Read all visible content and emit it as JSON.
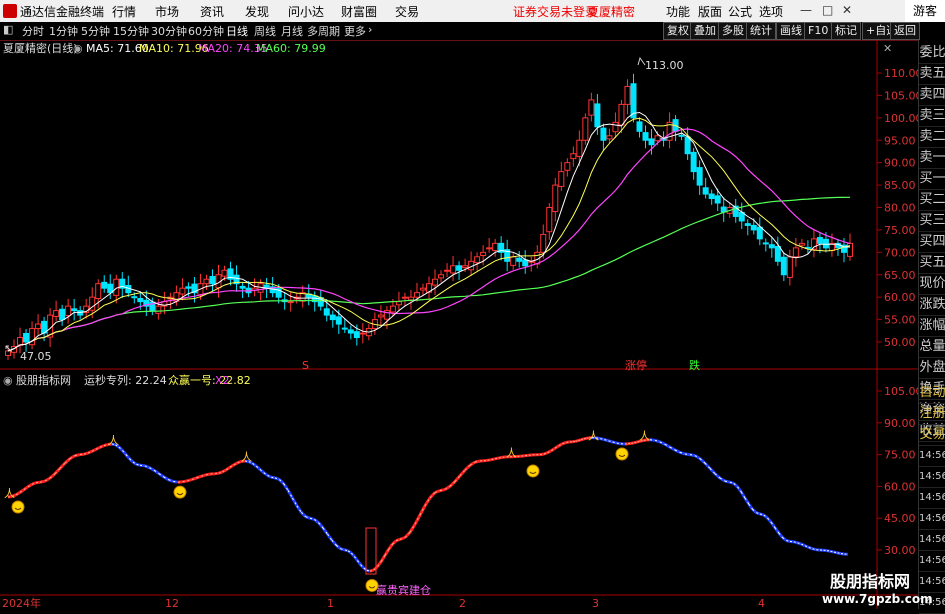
{
  "titlebar": {
    "app_title": "通达信金融终端",
    "menus": [
      "行情",
      "市场",
      "资讯",
      "发现",
      "问小达",
      "财富圈",
      "交易"
    ],
    "warning": "证券交易未登录",
    "warning2": "夏厦精密",
    "right_menus": [
      "功能",
      "版面",
      "公式",
      "选项"
    ],
    "guest": "游客"
  },
  "periods": [
    "分时",
    "1分钟",
    "5分钟",
    "15分钟",
    "30分钟",
    "60分钟",
    "日线",
    "周线",
    "月线",
    "多周期",
    "更多"
  ],
  "active_period": "日线",
  "right_tools": [
    "复权",
    "叠加",
    "多股",
    "统计",
    "画线",
    "F10",
    "标记",
    "+自选",
    "返回"
  ],
  "rail_items": [
    "委比",
    "卖五",
    "卖四",
    "卖三",
    "卖二",
    "卖一",
    "买一",
    "买二",
    "买三",
    "买四",
    "买五",
    "现价",
    "涨跌",
    "涨幅",
    "总量",
    "外盘",
    "换手",
    "净资",
    "收益"
  ],
  "rail_items_lower": [
    "自动",
    "注册",
    "交易",
    "14:56",
    "14:56",
    "14:56",
    "14:56",
    "14:56",
    "14:56",
    "14:56",
    "14:56"
  ],
  "price_panel": {
    "stock_label": "夏厦精密(日线)",
    "ma_labels": [
      {
        "text": "MA5: 71.60",
        "color": "#ffffff"
      },
      {
        "text": "MA10: 71.96",
        "color": "#ffff55"
      },
      {
        "text": "MA20: 74.35",
        "color": "#ff44ff"
      },
      {
        "text": "MA60: 79.99",
        "color": "#55ff55"
      }
    ],
    "high_label": "113.00",
    "low_label": "47.05",
    "y_ticks": [
      "110.00",
      "105.00",
      "100.00",
      "95.00",
      "90.00",
      "85.00",
      "80.00",
      "75.00",
      "70.00",
      "65.00",
      "60.00",
      "55.00",
      "50.00"
    ],
    "markers": [
      {
        "text": "S",
        "color": "#ff3333"
      },
      {
        "text": "涨停",
        "color": "#ff3333"
      },
      {
        "text": "跌",
        "color": "#33ff33"
      }
    ]
  },
  "indicator_panel": {
    "title": "股朋指标网",
    "label1": "运秒专列: 22.24",
    "label2": "众赢一号: 22.82",
    "label3": "X2:",
    "y_ticks": [
      "105.00",
      "90.00",
      "75.00",
      "60.00",
      "45.00",
      "30.00"
    ],
    "buy_label": "赢贵宾建仓"
  },
  "x_axis": [
    "2024年",
    "12",
    "1",
    "2",
    "3",
    "4"
  ],
  "watermark_cn": "股朋指标网",
  "watermark_url": "www.7gpzb.com",
  "colors": {
    "up": "#ff3333",
    "down": "#00e5ff",
    "ma5": "#ffffff",
    "ma10": "#ffff55",
    "ma20": "#ff44ff",
    "ma60": "#55ff55",
    "axis": "#aa0000"
  }
}
